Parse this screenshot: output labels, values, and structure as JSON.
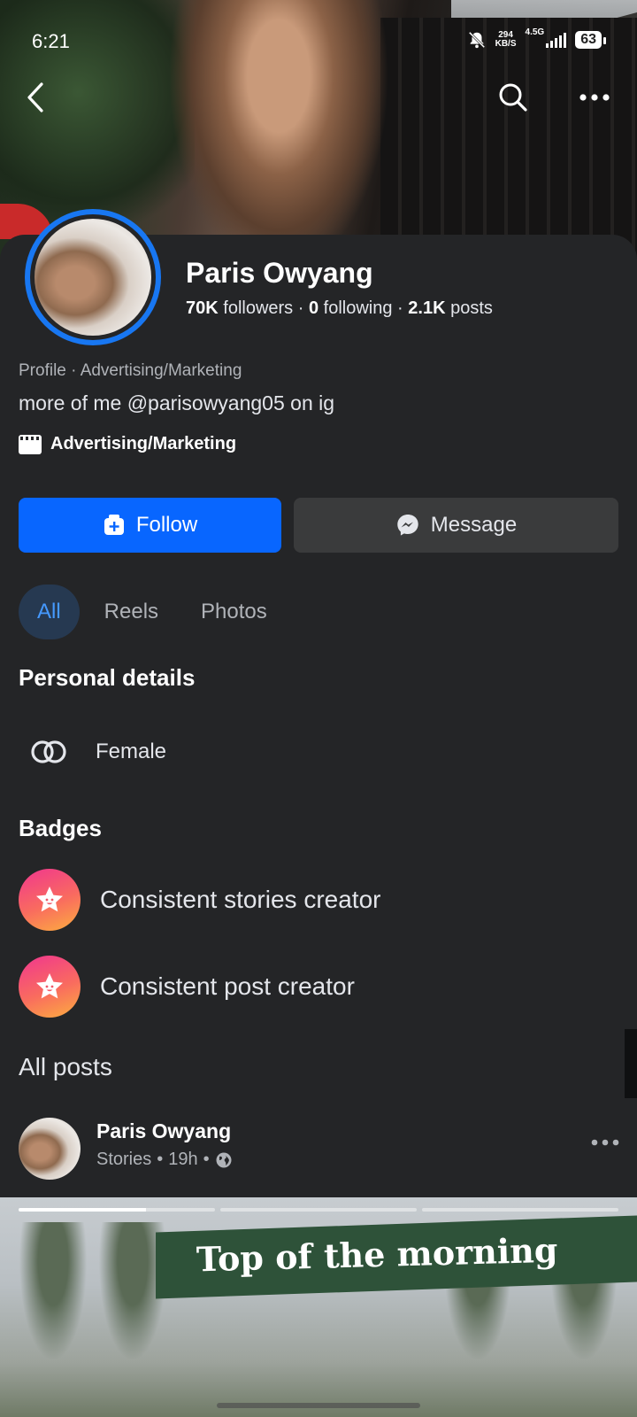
{
  "status_bar": {
    "time": "6:21",
    "net_speed_value": "294",
    "net_speed_unit": "KB/S",
    "network_type": "4.5G",
    "battery": "63"
  },
  "profile": {
    "name": "Paris Owyang",
    "followers_count": "70K",
    "followers_label": "followers",
    "following_count": "0",
    "following_label": "following",
    "posts_count": "2.1K",
    "posts_label": "posts",
    "category_line": "Profile · Advertising/Marketing",
    "bio": "more of me @parisowyang05 on ig",
    "category": "Advertising/Marketing"
  },
  "actions": {
    "follow_label": "Follow",
    "message_label": "Message"
  },
  "tabs": [
    {
      "label": "All",
      "active": true
    },
    {
      "label": "Reels",
      "active": false
    },
    {
      "label": "Photos",
      "active": false
    }
  ],
  "personal_details": {
    "heading": "Personal details",
    "gender": "Female"
  },
  "badges": {
    "heading": "Badges",
    "items": [
      {
        "label": "Consistent stories creator"
      },
      {
        "label": "Consistent post creator"
      }
    ]
  },
  "all_posts": {
    "heading": "All posts",
    "post": {
      "author": "Paris Owyang",
      "source": "Stories",
      "time": "19h",
      "story_text": "Top of the morning",
      "story_segments": 3,
      "story_progress_first_segment": 0.65
    }
  },
  "colors": {
    "accent": "#0866ff",
    "ring": "#1877f2",
    "background": "#242527",
    "tab_active_bg": "#263951",
    "tab_active_text": "#4599ff"
  }
}
